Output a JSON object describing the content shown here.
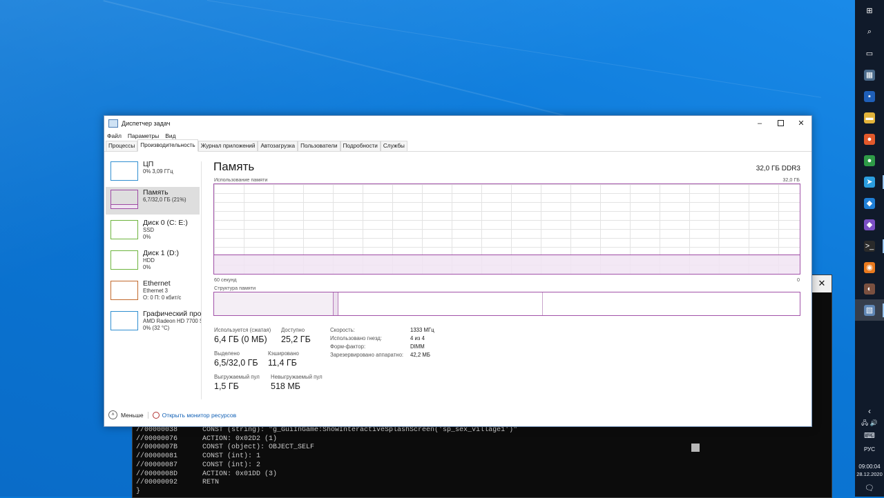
{
  "desktop": {},
  "taskbar": {
    "icons": [
      {
        "name": "windows-start-icon",
        "glyph": "⊞"
      },
      {
        "name": "search-icon",
        "glyph": "⌕"
      },
      {
        "name": "task-view-icon",
        "glyph": "▭"
      },
      {
        "name": "calculator-icon",
        "glyph": "▦"
      },
      {
        "name": "save-disk-icon",
        "glyph": "▪"
      },
      {
        "name": "file-explorer-icon",
        "glyph": "▬"
      },
      {
        "name": "firefox-icon",
        "glyph": "●"
      },
      {
        "name": "chrome-icon",
        "glyph": "●"
      },
      {
        "name": "telegram-icon",
        "glyph": "➤"
      },
      {
        "name": "vscode-icon",
        "glyph": "◆"
      },
      {
        "name": "visual-studio-icon",
        "glyph": "◆"
      },
      {
        "name": "terminal-icon",
        "glyph": ">_"
      },
      {
        "name": "blender-icon",
        "glyph": "◉"
      },
      {
        "name": "user-app-icon",
        "glyph": "◐"
      },
      {
        "name": "task-manager-icon",
        "glyph": "▧"
      }
    ],
    "tray": {
      "expand": "‹",
      "network_volume": "🖧 🔊",
      "keyboard": "⌨",
      "language": "РУС",
      "time": "09:00:04",
      "date": "28.12.2020",
      "notifications": "🗨"
    }
  },
  "console": {
    "close": "✕",
    "lines": [
      {
        "addr": "//00000038",
        "text": "CONST (string): \"g_GuiInGame:ShowInteractiveSplashScreen('sp_sex_village1')\""
      },
      {
        "addr": "//00000076",
        "text": "ACTION: 0x02D2 (1)"
      },
      {
        "addr": "//0000007B",
        "text": "CONST (object): OBJECT_SELF"
      },
      {
        "addr": "//00000081",
        "text": "CONST (int): 1"
      },
      {
        "addr": "//00000087",
        "text": "CONST (int): 2"
      },
      {
        "addr": "//0000008D",
        "text": "ACTION: 0x01DD (3)"
      },
      {
        "addr": "//00000092",
        "text": "RETN"
      },
      {
        "addr": "}",
        "text": ""
      }
    ]
  },
  "taskmgr": {
    "title": "Диспетчер задач",
    "menu": [
      "Файл",
      "Параметры",
      "Вид"
    ],
    "tabs": [
      "Процессы",
      "Производительность",
      "Журнал приложений",
      "Автозагрузка",
      "Пользователи",
      "Подробности",
      "Службы"
    ],
    "sidebar": [
      {
        "name": "ЦП",
        "sub1": "0% 3,09 ГГц",
        "sub2": "",
        "color": "#2f8ed0"
      },
      {
        "name": "Память",
        "sub1": "6,7/32,0 ГБ (21%)",
        "sub2": "",
        "color": "#9d49a3"
      },
      {
        "name": "Диск 0 (C: E:)",
        "sub1": "SSD",
        "sub2": "0%",
        "color": "#6cb43c"
      },
      {
        "name": "Диск 1 (D:)",
        "sub1": "HDD",
        "sub2": "0%",
        "color": "#6cb43c"
      },
      {
        "name": "Ethernet",
        "sub1": "Ethernet 3",
        "sub2": "О: 0 П: 0 кбит/с",
        "color": "#c1692c"
      },
      {
        "name": "Графический про",
        "sub1": "AMD Radeon HD 7700 S",
        "sub2": "0% (32 °C)",
        "color": "#2f8ed0"
      }
    ],
    "main": {
      "title": "Память",
      "ram_type": "32,0 ГБ DDR3",
      "usage_label": "Использование памяти",
      "usage_max": "32,0 ГБ",
      "time_left": "60 секунд",
      "time_right": "0",
      "structure_label": "Структура памяти",
      "usage_fraction": 0.21,
      "stats": {
        "in_use_label": "Используется (сжатая)",
        "in_use_value": "6,4 ГБ (0 МБ)",
        "available_label": "Доступно",
        "available_value": "25,2 ГБ",
        "committed_label": "Выделено",
        "committed_value": "6,5/32,0 ГБ",
        "cached_label": "Кэшировано",
        "cached_value": "11,4 ГБ",
        "paged_label": "Выгружаемый пул",
        "paged_value": "1,5 ГБ",
        "nonpaged_label": "Невыгружаемый пул",
        "nonpaged_value": "518 МБ"
      },
      "details": [
        {
          "label": "Скорость:",
          "value": "1333 МГц"
        },
        {
          "label": "Использовано гнезд:",
          "value": "4 из 4"
        },
        {
          "label": "Форм-фактор:",
          "value": "DIMM"
        },
        {
          "label": "Зарезервировано аппаратно:",
          "value": "42,2 МБ"
        }
      ]
    },
    "footer": {
      "less": "Меньше",
      "resmon": "Открыть монитор ресурсов"
    }
  }
}
